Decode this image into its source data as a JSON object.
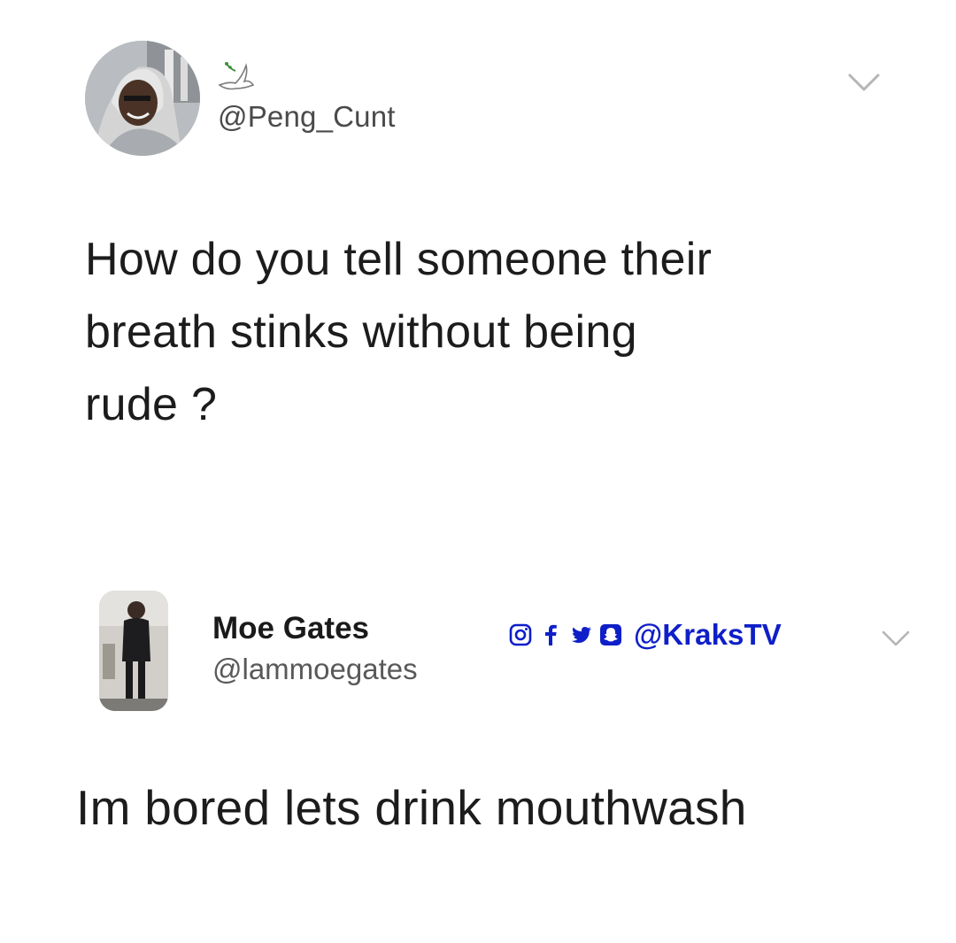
{
  "colors": {
    "background": "#ffffff",
    "text": "#1c1c1c",
    "handle": "#4a4a4a",
    "social_accent": "#0f1fc8",
    "chevron": "#b5b5b5"
  },
  "original_tweet": {
    "handle": "@Peng_Cunt",
    "name_icon": "dove-icon",
    "text": "How do you tell someone their\nbreath stinks without being\nrude ?",
    "menu_icon": "chevron-down-icon"
  },
  "reply_tweet": {
    "name": "Moe Gates",
    "handle": "@lammoegates",
    "social_icons": [
      "instagram-icon",
      "facebook-icon",
      "twitter-icon",
      "snapchat-icon"
    ],
    "social_handle": "@KraksTV",
    "text": "Im bored lets drink mouthwash",
    "menu_icon": "chevron-down-icon"
  }
}
